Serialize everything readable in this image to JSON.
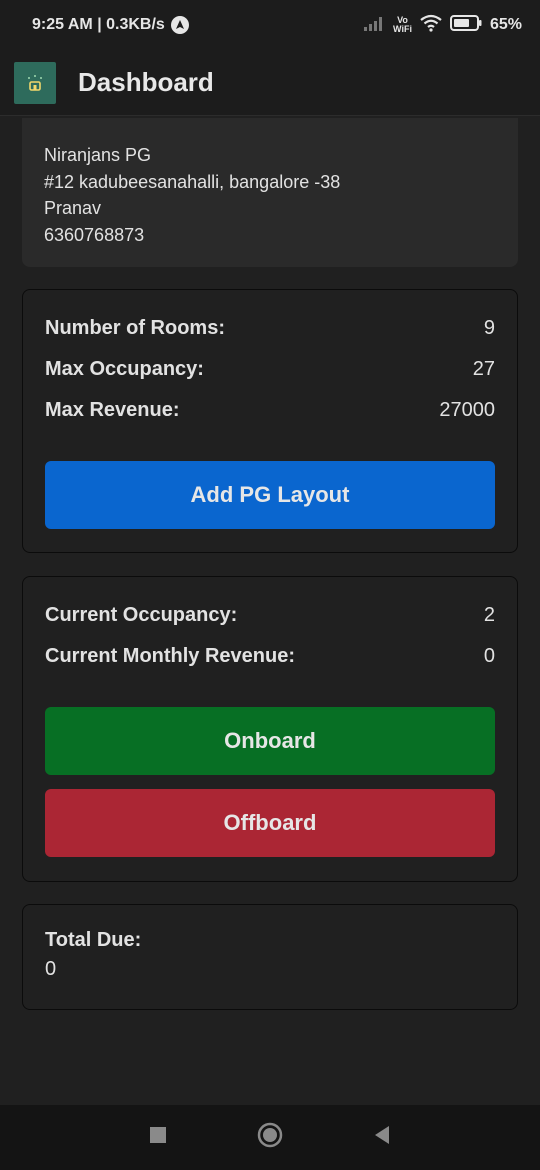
{
  "status_bar": {
    "time_speed": "9:25 AM | 0.3KB/s",
    "battery": "65%",
    "volte": "Vo\nWiFi"
  },
  "app_bar": {
    "title": "Dashboard"
  },
  "pg_info": {
    "name": "Niranjans PG",
    "address": "#12 kadubeesanahalli, bangalore -38",
    "owner": "Pranav",
    "phone": "6360768873"
  },
  "capacity": {
    "rooms_label": "Number of Rooms:",
    "rooms_value": "9",
    "occupancy_label": "Max Occupancy:",
    "occupancy_value": "27",
    "revenue_label": "Max Revenue:",
    "revenue_value": "27000",
    "add_layout_label": "Add PG Layout"
  },
  "current": {
    "occupancy_label": "Current Occupancy:",
    "occupancy_value": "2",
    "revenue_label": "Current Monthly Revenue:",
    "revenue_value": "0",
    "onboard_label": "Onboard",
    "offboard_label": "Offboard"
  },
  "due": {
    "label": "Total Due:",
    "value": "0"
  },
  "colors": {
    "accent_blue": "#0a66cf",
    "accent_green": "#076f24",
    "accent_red": "#ab2634"
  }
}
